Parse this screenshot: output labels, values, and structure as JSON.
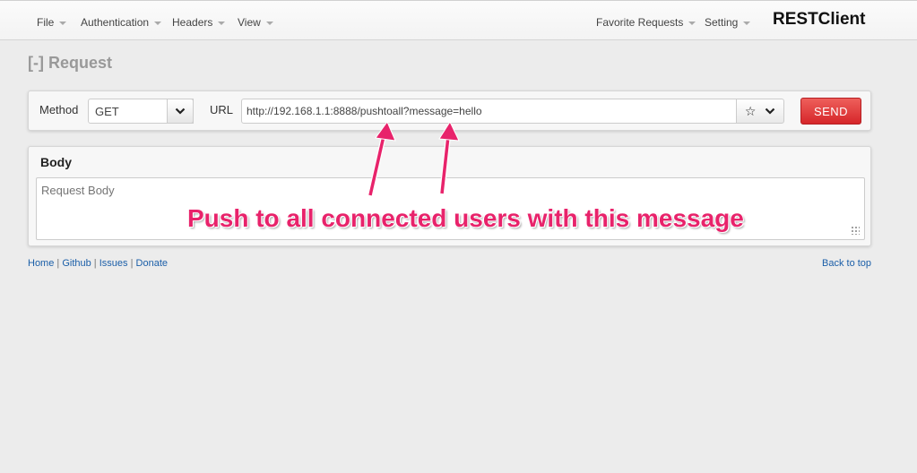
{
  "navbar": {
    "items": [
      {
        "label": "File"
      },
      {
        "label": "Authentication"
      },
      {
        "label": "Headers"
      },
      {
        "label": "View"
      }
    ],
    "right_items": [
      {
        "label": "Favorite Requests"
      },
      {
        "label": "Setting"
      }
    ],
    "brand": "RESTClient"
  },
  "request": {
    "heading": "[-] Request",
    "method_label": "Method",
    "method_value": "GET",
    "url_label": "URL",
    "url_value": "http://192.168.1.1:8888/pushtoall?message=hello",
    "star_glyph": "☆",
    "chevron_glyph": "⌄",
    "send_label": "SEND"
  },
  "body": {
    "title": "Body",
    "placeholder": "Request Body"
  },
  "footer": {
    "links": [
      "Home",
      "Github",
      "Issues",
      "Donate"
    ],
    "back_to_top": "Back to top"
  },
  "annotation": {
    "text": "Push to all connected users with this message",
    "color": "#e8236b"
  },
  "colors": {
    "send_button": "#d6262a",
    "background": "#ececec"
  }
}
